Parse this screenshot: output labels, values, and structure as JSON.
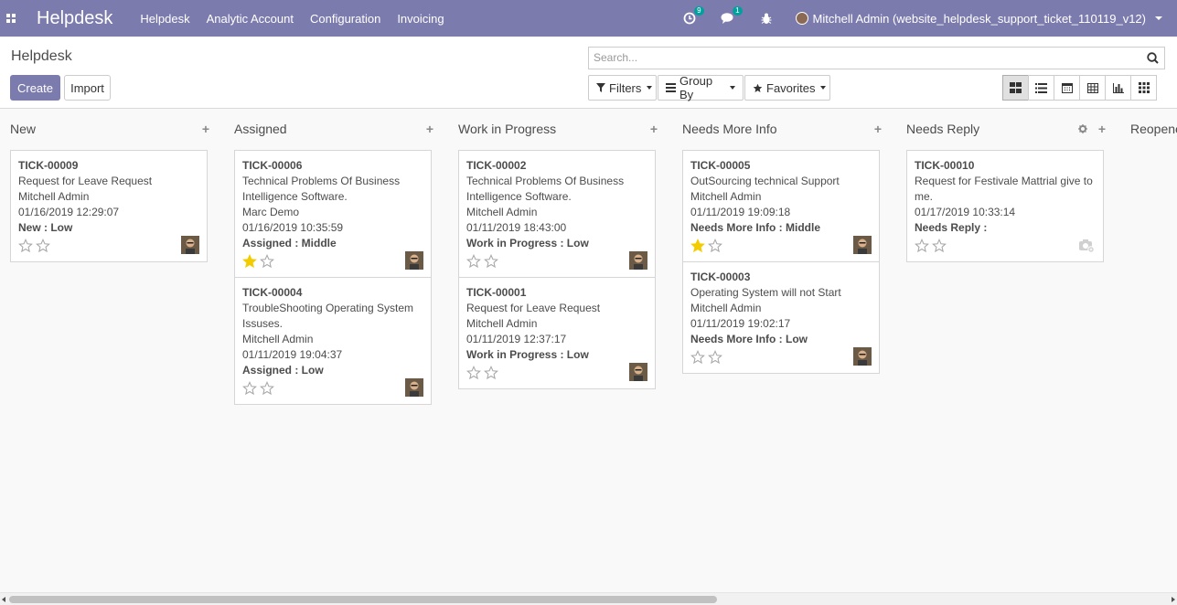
{
  "navbar": {
    "brand": "Helpdesk",
    "menu": [
      "Helpdesk",
      "Analytic Account",
      "Configuration",
      "Invoicing"
    ],
    "activity_count": "9",
    "messages_count": "1",
    "user_name": "Mitchell Admin (website_helpdesk_support_ticket_110119_v12)"
  },
  "control": {
    "breadcrumb": "Helpdesk",
    "create_label": "Create",
    "import_label": "Import",
    "search_placeholder": "Search...",
    "filters_label": "Filters",
    "groupby_label": "Group By",
    "favorites_label": "Favorites",
    "views": [
      "kanban",
      "list",
      "calendar",
      "pivot",
      "graph",
      "grid"
    ],
    "active_view": "kanban"
  },
  "columns": [
    {
      "title": "New",
      "cards": [
        {
          "ref": "TICK-00009",
          "lines": [
            "Request for Leave Request",
            "Mitchell Admin",
            "01/16/2019 12:29:07"
          ],
          "stage": "New : Low",
          "stars": 0,
          "avatar": "photo"
        }
      ]
    },
    {
      "title": "Assigned",
      "cards": [
        {
          "ref": "TICK-00006",
          "lines": [
            "Technical Problems Of Business",
            "Intelligence Software.",
            "Marc Demo",
            "01/16/2019 10:35:59"
          ],
          "stage": "Assigned : Middle",
          "stars": 1,
          "avatar": "photo"
        },
        {
          "ref": "TICK-00004",
          "lines": [
            "TroubleShooting Operating System",
            "Issuses.",
            "Mitchell Admin",
            "01/11/2019 19:04:37"
          ],
          "stage": "Assigned : Low",
          "stars": 0,
          "avatar": "photo"
        }
      ]
    },
    {
      "title": "Work in Progress",
      "cards": [
        {
          "ref": "TICK-00002",
          "lines": [
            "Technical Problems Of Business",
            "Intelligence Software.",
            "Mitchell Admin",
            "01/11/2019 18:43:00"
          ],
          "stage": "Work in Progress : Low",
          "stars": 0,
          "avatar": "photo"
        },
        {
          "ref": "TICK-00001",
          "lines": [
            "Request for Leave Request",
            "Mitchell Admin",
            "01/11/2019 12:37:17"
          ],
          "stage": "Work in Progress : Low",
          "stars": 0,
          "avatar": "photo"
        }
      ]
    },
    {
      "title": "Needs More Info",
      "cards": [
        {
          "ref": "TICK-00005",
          "lines": [
            "OutSourcing technical Support",
            "Mitchell Admin",
            "01/11/2019 19:09:18"
          ],
          "stage": "Needs More Info : Middle",
          "stars": 1,
          "avatar": "photo"
        },
        {
          "ref": "TICK-00003",
          "lines": [
            "Operating System will not Start",
            "Mitchell Admin",
            "01/11/2019 19:02:17"
          ],
          "stage": "Needs More Info : Low",
          "stars": 0,
          "avatar": "photo"
        }
      ]
    },
    {
      "title": "Needs Reply",
      "cards": [
        {
          "ref": "TICK-00010",
          "lines": [
            "Request for Festivale Mattrial give to",
            "me.",
            "01/17/2019 10:33:14"
          ],
          "stage": "Needs Reply :",
          "stars": 0,
          "avatar": "placeholder"
        }
      ]
    },
    {
      "title": "Reopened",
      "cards": []
    }
  ],
  "colors": {
    "brand": "#7c7bad",
    "star_on": "#f3cc00",
    "star_off": "#a8a8a8"
  }
}
